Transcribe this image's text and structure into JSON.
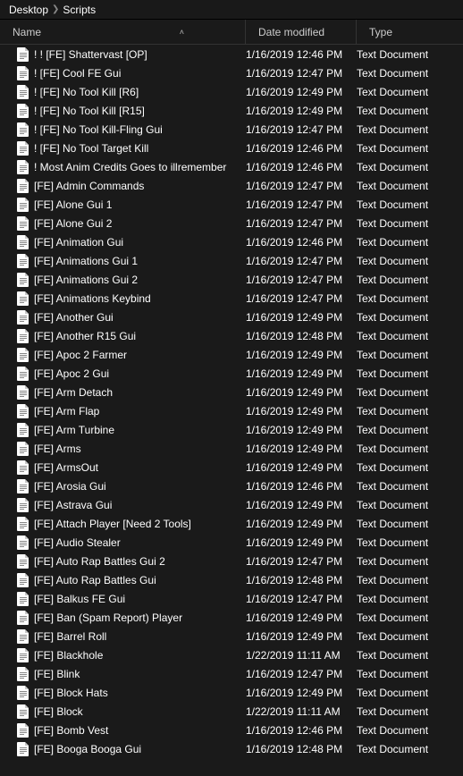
{
  "breadcrumb": [
    "Desktop",
    "Scripts"
  ],
  "columns": {
    "name": "Name",
    "date": "Date modified",
    "type": "Type"
  },
  "type_label": "Text Document",
  "files": [
    {
      "name": "! ! [FE] Shattervast [OP]",
      "date": "1/16/2019 12:46 PM"
    },
    {
      "name": "! [FE] Cool FE Gui",
      "date": "1/16/2019 12:47 PM"
    },
    {
      "name": "! [FE] No Tool Kill [R6]",
      "date": "1/16/2019 12:49 PM"
    },
    {
      "name": "! [FE] No Tool Kill [R15]",
      "date": "1/16/2019 12:49 PM"
    },
    {
      "name": "! [FE] No Tool Kill-Fling Gui",
      "date": "1/16/2019 12:47 PM"
    },
    {
      "name": "! [FE] No Tool Target Kill",
      "date": "1/16/2019 12:46 PM"
    },
    {
      "name": "! Most Anim Credits Goes to illremember",
      "date": "1/16/2019 12:46 PM"
    },
    {
      "name": "[FE] Admin Commands",
      "date": "1/16/2019 12:47 PM"
    },
    {
      "name": "[FE] Alone Gui 1",
      "date": "1/16/2019 12:47 PM"
    },
    {
      "name": "[FE] Alone Gui 2",
      "date": "1/16/2019 12:47 PM"
    },
    {
      "name": "[FE] Animation Gui",
      "date": "1/16/2019 12:46 PM"
    },
    {
      "name": "[FE] Animations Gui 1",
      "date": "1/16/2019 12:47 PM"
    },
    {
      "name": "[FE] Animations Gui 2",
      "date": "1/16/2019 12:47 PM"
    },
    {
      "name": "[FE] Animations Keybind",
      "date": "1/16/2019 12:47 PM"
    },
    {
      "name": "[FE] Another Gui",
      "date": "1/16/2019 12:49 PM"
    },
    {
      "name": "[FE] Another R15 Gui",
      "date": "1/16/2019 12:48 PM"
    },
    {
      "name": "[FE] Apoc 2 Farmer",
      "date": "1/16/2019 12:49 PM"
    },
    {
      "name": "[FE] Apoc 2 Gui",
      "date": "1/16/2019 12:49 PM"
    },
    {
      "name": "[FE] Arm Detach",
      "date": "1/16/2019 12:49 PM"
    },
    {
      "name": "[FE] Arm Flap",
      "date": "1/16/2019 12:49 PM"
    },
    {
      "name": "[FE] Arm Turbine",
      "date": "1/16/2019 12:49 PM"
    },
    {
      "name": "[FE] Arms",
      "date": "1/16/2019 12:49 PM"
    },
    {
      "name": "[FE] ArmsOut",
      "date": "1/16/2019 12:49 PM"
    },
    {
      "name": "[FE] Arosia Gui",
      "date": "1/16/2019 12:46 PM"
    },
    {
      "name": "[FE] Astrava Gui",
      "date": "1/16/2019 12:49 PM"
    },
    {
      "name": "[FE] Attach Player [Need 2 Tools]",
      "date": "1/16/2019 12:49 PM"
    },
    {
      "name": "[FE] Audio Stealer",
      "date": "1/16/2019 12:49 PM"
    },
    {
      "name": "[FE] Auto Rap Battles Gui 2",
      "date": "1/16/2019 12:47 PM"
    },
    {
      "name": "[FE] Auto Rap Battles Gui",
      "date": "1/16/2019 12:48 PM"
    },
    {
      "name": "[FE] Balkus FE Gui",
      "date": "1/16/2019 12:47 PM"
    },
    {
      "name": "[FE] Ban (Spam Report) Player",
      "date": "1/16/2019 12:49 PM"
    },
    {
      "name": "[FE] Barrel Roll",
      "date": "1/16/2019 12:49 PM"
    },
    {
      "name": "[FE] Blackhole",
      "date": "1/22/2019 11:11 AM"
    },
    {
      "name": "[FE] Blink",
      "date": "1/16/2019 12:47 PM"
    },
    {
      "name": "[FE] Block Hats",
      "date": "1/16/2019 12:49 PM"
    },
    {
      "name": "[FE] Block",
      "date": "1/22/2019 11:11 AM"
    },
    {
      "name": "[FE] Bomb Vest",
      "date": "1/16/2019 12:46 PM"
    },
    {
      "name": "[FE] Booga Booga Gui",
      "date": "1/16/2019 12:48 PM"
    }
  ]
}
